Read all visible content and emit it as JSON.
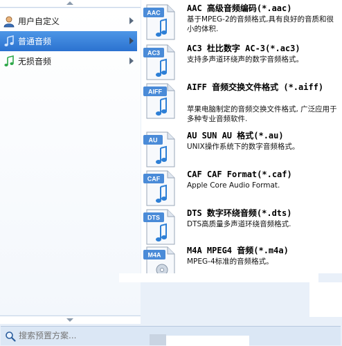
{
  "sidebar": {
    "items": [
      {
        "label": "用户自定义",
        "icon": "user-icon",
        "selected": false
      },
      {
        "label": "普通音频",
        "icon": "music-note-icon",
        "selected": true
      },
      {
        "label": "无损音频",
        "icon": "music-note-icon",
        "selected": false
      }
    ]
  },
  "formats": [
    {
      "badge": "AAC",
      "title": "AAC 高级音频编码(*.aac)",
      "desc": "基于MPEG-2的音频格式,具有良好的音质和很小的体积."
    },
    {
      "badge": "AC3",
      "title": "AC3 杜比数字 AC-3(*.ac3)",
      "desc": "支持多声道环绕声的数字音频格式。"
    },
    {
      "badge": "AIFF",
      "title": "AIFF 音频交换文件格式 (*.aiff)",
      "desc": "苹果电脑制定的音频交换文件格式, 广泛应用于多种专业音频软件."
    },
    {
      "badge": "AU",
      "title": "AU SUN AU 格式(*.au)",
      "desc": "UNIX操作系统下的数字音频格式。"
    },
    {
      "badge": "CAF",
      "title": "CAF CAF Format(*.caf)",
      "desc": "Apple Core Audio Format."
    },
    {
      "badge": "DTS",
      "title": "DTS 数字环绕音频(*.dts)",
      "desc": "DTS高质量多声道环绕音频格式."
    },
    {
      "badge": "M4A",
      "title": "M4A MPEG4 音频(*.m4a)",
      "desc": "MPEG-4标准的音频格式。"
    }
  ],
  "search": {
    "placeholder": "搜索预置方案...",
    "value": ""
  },
  "colors": {
    "selected_bg": "#2f78d4",
    "badge_bg": "#4a8bd8",
    "note_color": "#2d7fd6"
  }
}
